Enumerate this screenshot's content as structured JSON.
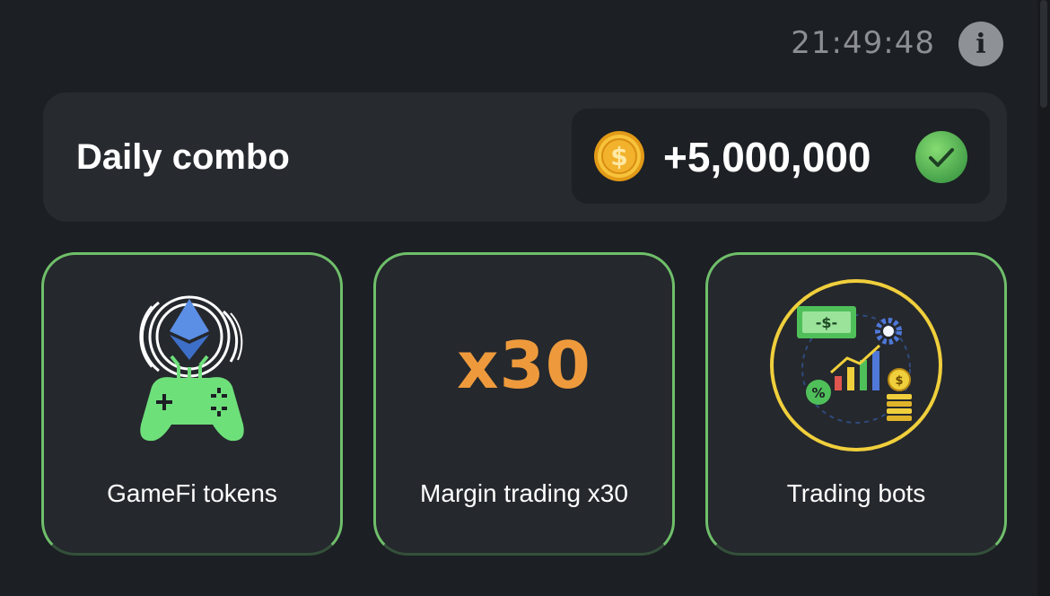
{
  "header": {
    "timer": "21:49:48",
    "info_label": "i"
  },
  "daily_combo": {
    "title": "Daily combo",
    "reward": "+5,000,000",
    "coin_symbol": "$",
    "coin_icon": "gold-coin-icon",
    "status_icon": "checkmark-icon",
    "claimed": true
  },
  "cards": [
    {
      "label": "GameFi tokens",
      "icon": "gamepad-ethereum-icon",
      "highlighted": true
    },
    {
      "label": "Margin trading x30",
      "badge": "x30",
      "highlighted": true
    },
    {
      "label": "Trading bots",
      "icon": "trading-bots-icon",
      "highlighted": true
    }
  ],
  "colors": {
    "background": "#1c1f24",
    "panel": "#272a2f",
    "card_border": "#6fbf6a",
    "accent_orange": "#ee9a3c",
    "gamepad_green": "#6ee07a",
    "ethereum_blue": "#5b8fe6",
    "coin_gold": "#f2b22c"
  }
}
